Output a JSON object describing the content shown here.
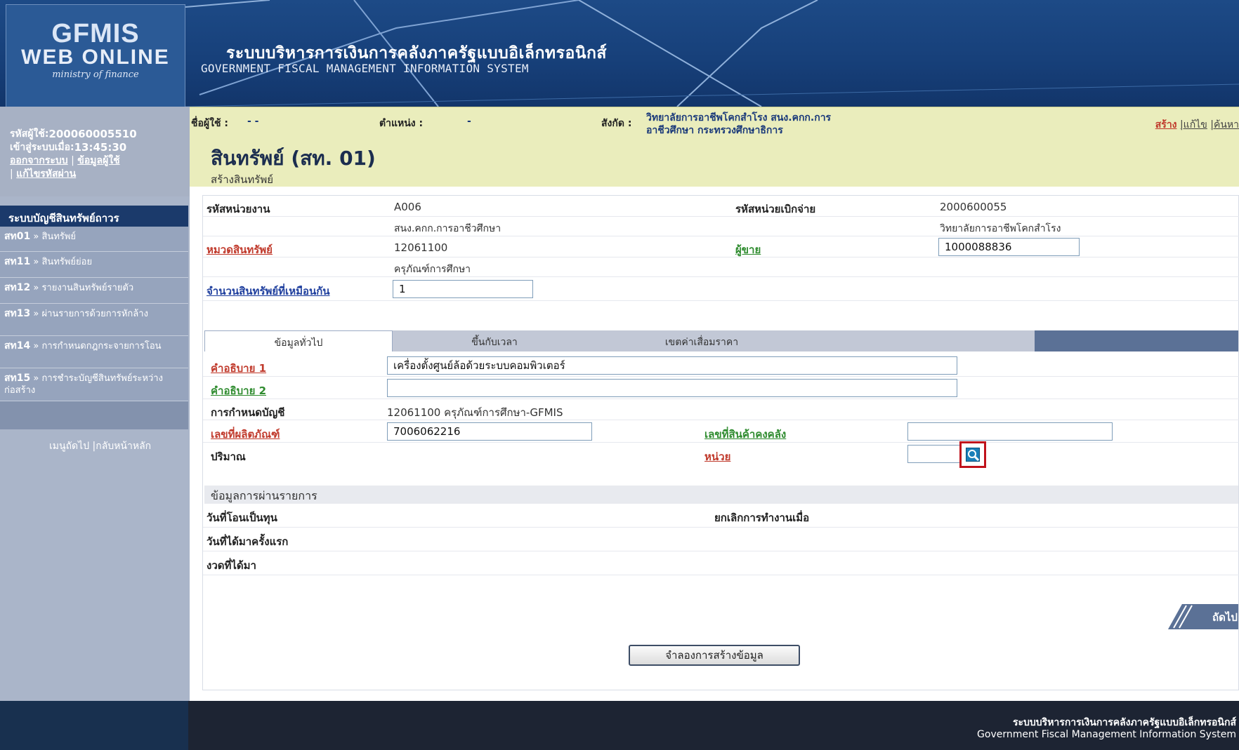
{
  "header": {
    "logo_line1": "GFMIS",
    "logo_line2": "WEB ONLINE",
    "logo_line3": "ministry of finance",
    "title_th": "ระบบบริหารการเงินการคลังภาครัฐแบบอิเล็กทรอนิกส์",
    "title_en": "GOVERNMENT FISCAL MANAGEMENT INFORMATION SYSTEM"
  },
  "user": {
    "id_label": "รหัสผู้ใช้:",
    "id_value": "200060005510",
    "login_label": "เข้าสู่ระบบเมื่อ:",
    "login_time": "13:45:30",
    "logout_link": "ออกจากระบบ",
    "profile_link": "ข้อมูลผู้ใช้",
    "change_password_link": "แก้ไขรหัสผ่าน",
    "separator": "|"
  },
  "sidebar": {
    "title": "ระบบบัญชีสินทรัพย์ถาวร",
    "items": [
      {
        "code": "สท01",
        "label": "» สินทรัพย์"
      },
      {
        "code": "สท11",
        "label": "» สินทรัพย์ย่อย"
      },
      {
        "code": "สท12",
        "label": "» รายงานสินทรัพย์รายตัว"
      },
      {
        "code": "สท13",
        "label": "» ผ่านรายการด้วยการหักล้าง"
      },
      {
        "code": "สท14",
        "label": "» การกำหนดกฎกระจายการโอน"
      },
      {
        "code": "สท15",
        "label": "» การชำระบัญชีสินทรัพย์ระหว่างก่อสร้าง"
      }
    ],
    "next_menu": "เมนูถัดไป |กลับหน้าหลัก"
  },
  "info_bar": {
    "user_name_label": "ชื่อผู้ใช้ :",
    "user_name_value": "- -",
    "position_label": "ตำแหน่ง :",
    "position_value": "-",
    "affiliation_label": "สังกัด :",
    "affiliation_line1": "วิทยาลัยการอาชีพโคกสำโรง สนง.คกก.การ",
    "affiliation_line2": "อาชีวศึกษา กระทรวงศึกษาธิการ",
    "action_create": "สร้าง",
    "action_edit": "|แก้ไข",
    "action_search": "|ค้นหา"
  },
  "page": {
    "title": "สินทรัพย์ (สท. 01)",
    "subtitle": "สร้างสินทรัพย์"
  },
  "form": {
    "org_code_label": "รหัสหน่วยงาน",
    "org_code_value": "A006",
    "org_name": "สนง.คกก.การอาชีวศึกษา",
    "disb_unit_label": "รหัสหน่วยเบิกจ่าย",
    "disb_unit_value": "2000600055",
    "disb_unit_name": "วิทยาลัยการอาชีพโคกสำโรง",
    "asset_class_label": "หมวดสินทรัพย์",
    "asset_class_value": "12061100",
    "asset_class_name": "ครุภัณฑ์การศึกษา",
    "seller_label": "ผู้ขาย",
    "seller_value": "1000088836",
    "same_assets_label": "จำนวนสินทรัพย์ที่เหมือนกัน",
    "same_assets_value": "1"
  },
  "tabs": {
    "general": "ข้อมูลทั่วไป",
    "time_based": "ขึ้นกับเวลา",
    "depreciation": "เขตค่าเสื่อมราคา"
  },
  "general": {
    "desc1_label": "คำอธิบาย 1",
    "desc1_value": "เครื่องตั้งศูนย์ล้อด้วยระบบคอมพิวเตอร์",
    "desc2_label": "คำอธิบาย 2",
    "desc2_value": "",
    "account_label": "การกำหนดบัญชี",
    "account_value": "12061100 ครุภัณฑ์การศึกษา-GFMIS",
    "serial_label": "เลขที่ผลิตภัณฑ์",
    "serial_value": "7006062216",
    "inventory_label": "เลขที่สินค้าคงคลัง",
    "inventory_value": "",
    "quantity_label": "ปริมาณ",
    "unit_label": "หน่วย",
    "unit_value": ""
  },
  "posting": {
    "section_title": "ข้อมูลการผ่านรายการ",
    "capitalization_label": "วันที่โอนเป็นทุน",
    "deactivation_label": "ยกเลิกการทำงานเมื่อ",
    "first_acquired_label": "วันที่ได้มาครั้งแรก",
    "period_label": "งวดที่ได้มา"
  },
  "buttons": {
    "next": "ถัดไป »",
    "simulate": "จำลองการสร้างข้อมูล"
  },
  "footer": {
    "line_th": "ระบบบริหารการเงินการคลังภาครัฐแบบอิเล็กทรอนิกส์",
    "line_en": "Government Fiscal Management Information System"
  },
  "colors": {
    "header_blue": "#1d4a86",
    "sidebar_bg": "#aab5c9",
    "info_bar_bg": "#eaedbc",
    "required_red": "#c0392b",
    "optional_green": "#2e8b2e"
  },
  "icons": {
    "search": "search-icon"
  }
}
